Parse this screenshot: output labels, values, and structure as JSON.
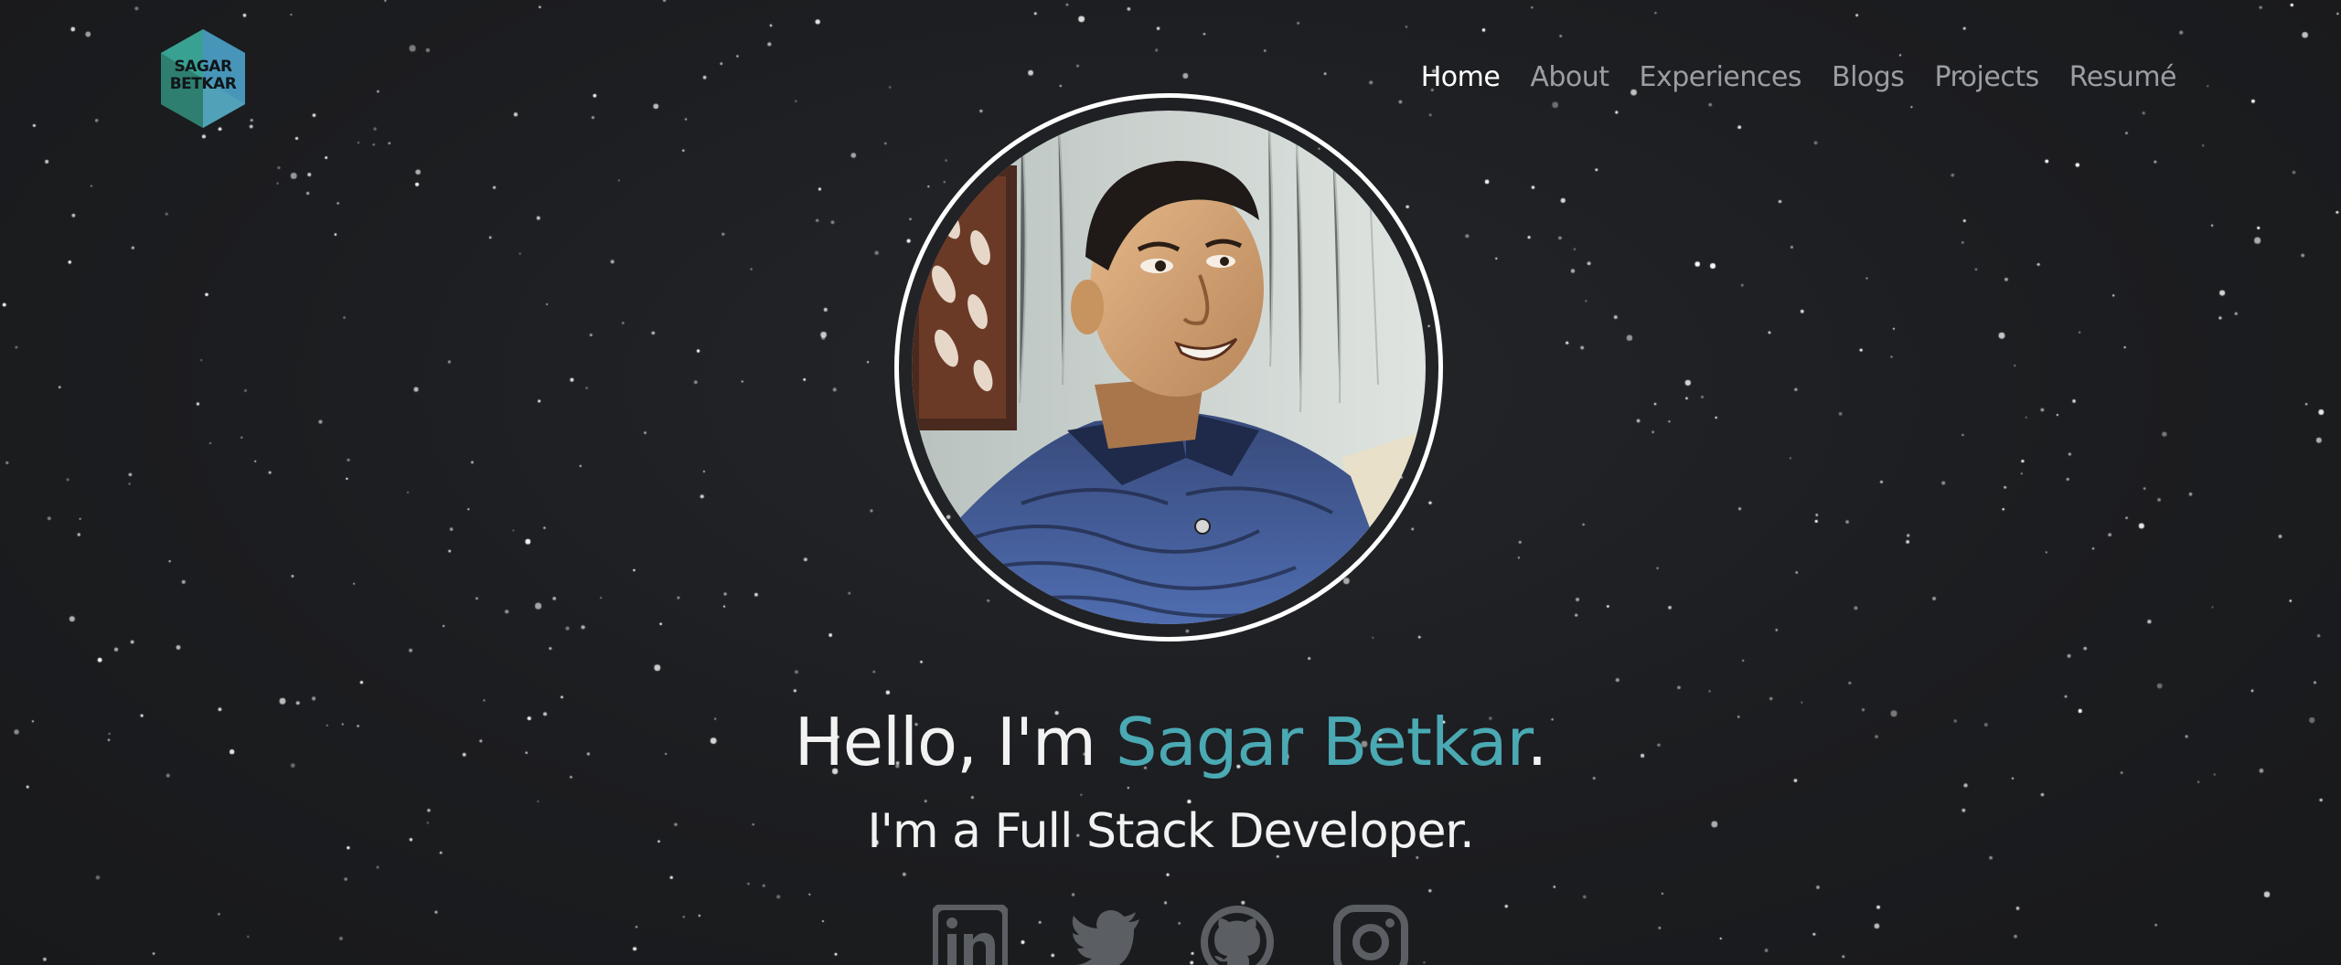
{
  "site": {
    "logo": {
      "line1": "SAGAR",
      "line2": "BETKAR",
      "colors": [
        "#3aa6a0",
        "#4a95b8",
        "#3b8a7e"
      ]
    }
  },
  "nav": {
    "items": [
      {
        "label": "Home",
        "active": true
      },
      {
        "label": "About",
        "active": false
      },
      {
        "label": "Experiences",
        "active": false
      },
      {
        "label": "Blogs",
        "active": false
      },
      {
        "label": "Projects",
        "active": false
      },
      {
        "label": "Resumé",
        "active": false
      }
    ]
  },
  "hero": {
    "greeting": "Hello, I'm ",
    "name": "Sagar Betkar",
    "period": ".",
    "subtitle": "I'm a Full Stack Developer."
  },
  "socials": [
    {
      "name": "linkedin-icon"
    },
    {
      "name": "twitter-icon"
    },
    {
      "name": "github-icon"
    },
    {
      "name": "instagram-icon"
    }
  ],
  "colors": {
    "background": "#1c1d20",
    "accent": "#4aa9b3",
    "nav_inactive": "#9a9ea4",
    "nav_active": "#ffffff",
    "social_icon": "#5b5e62"
  }
}
